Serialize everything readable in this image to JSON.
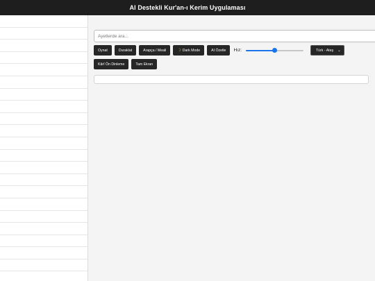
{
  "header": {
    "title": "AI Destekli Kur'an-ı Kerim Uygulaması"
  },
  "search": {
    "placeholder": "Ayetlerde ara..."
  },
  "controls": {
    "play_label": "Oynat",
    "pause_label": "Duraklat",
    "arabic_toggle_label": "Arapça / Meali",
    "dark_mode_label": "Dark Mode",
    "dark_mode_icon": "moon-icon",
    "ai_summary_label": "AI Özetle",
    "speed_label": "Hız:",
    "speed_value_fraction": 0.5,
    "language_selected": "Türk - Ateş",
    "preview_label": "Kârî Ön Dinleme",
    "fullscreen_label": "Tam Ekran"
  },
  "colors": {
    "header_bg": "#1e1e1e",
    "button_bg": "#262626",
    "accent": "#1a73e8"
  }
}
